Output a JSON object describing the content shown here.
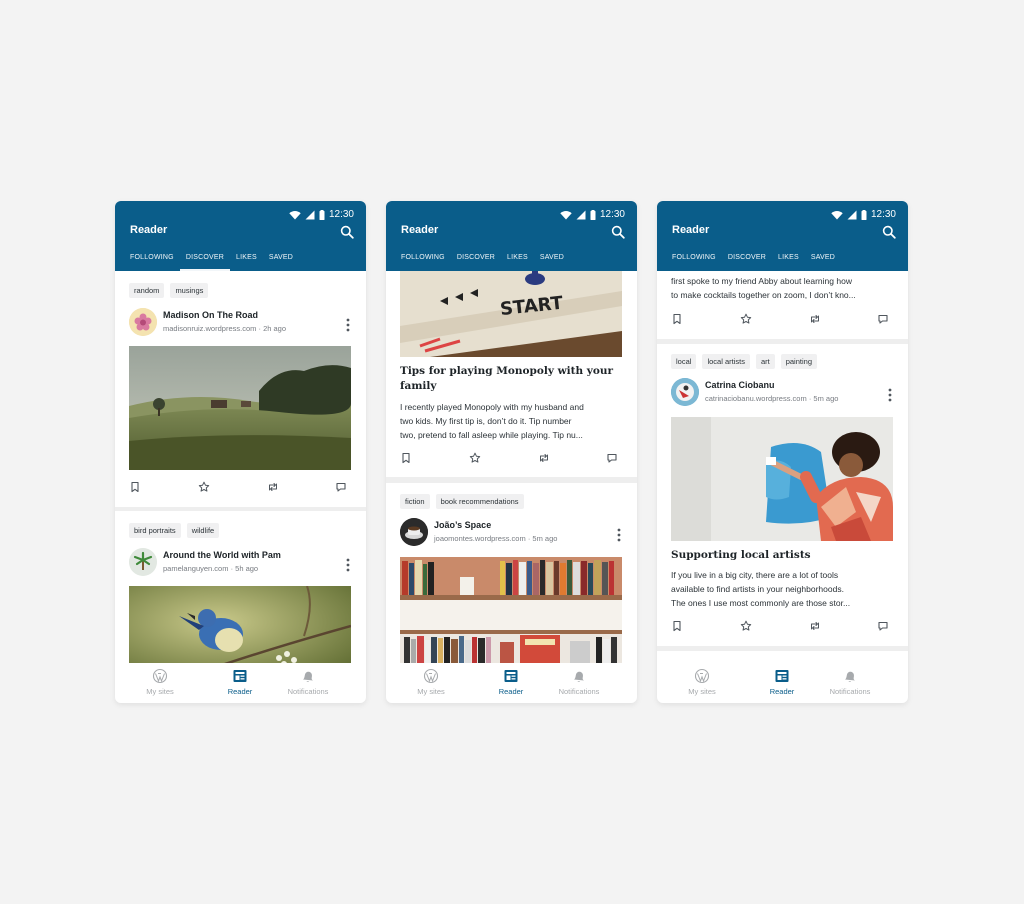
{
  "phones": [
    {
      "status": {
        "time": "12:30"
      },
      "app_title": "Reader",
      "tabs": [
        "FOLLOWING",
        "DISCOVER",
        "LIKES",
        "SAVED"
      ],
      "active_tab": "DISCOVER",
      "posts": [
        {
          "tags": [
            "random",
            "musings"
          ],
          "site_name": "Madison On The Road",
          "site_url": "madisonruiz.wordpress.com",
          "time": "2h ago",
          "image": "rolling-hills-landscape"
        },
        {
          "tags": [
            "bird portraits",
            "wildlife"
          ],
          "site_name": "Around the World with Pam",
          "site_url": "pamelanguyen.com",
          "time": "5h ago",
          "image": "blue-bird-on-branch"
        }
      ],
      "bottom_nav": [
        "My sites",
        "Reader",
        "Notifications"
      ],
      "active_nav": "Reader"
    },
    {
      "status": {
        "time": "12:30"
      },
      "app_title": "Reader",
      "tabs": [
        "FOLLOWING",
        "DISCOVER",
        "LIKES",
        "SAVED"
      ],
      "active_tab": "DISCOVER",
      "posts": [
        {
          "image_text": "START",
          "title_line1": "Tips for playing Monopoly with your",
          "title_line2": "family",
          "excerpt": [
            "I recently played Monopoly with my husband and",
            "two kids. My first tip is, don’t do it. Tip number",
            "two, pretend to fall asleep while playing. Tip nu..."
          ]
        },
        {
          "tags": [
            "fiction",
            "book recommendations"
          ],
          "site_name": "João’s Space",
          "site_url": "joaomontes.wordpress.com",
          "time": "5m ago",
          "image": "bookshelf"
        }
      ],
      "bottom_nav": [
        "My sites",
        "Reader",
        "Notifications"
      ],
      "active_nav": "Reader"
    },
    {
      "status": {
        "time": "12:30"
      },
      "app_title": "Reader",
      "tabs": [
        "FOLLOWING",
        "DISCOVER",
        "LIKES",
        "SAVED"
      ],
      "active_tab": "DISCOVER",
      "posts": [
        {
          "excerpt": [
            "first spoke to my friend Abby about learning how",
            "to make cocktails together on zoom, I don’t kno..."
          ]
        },
        {
          "tags": [
            "local",
            "local artists",
            "art",
            "painting"
          ],
          "site_name": "Catrina Ciobanu",
          "site_url": "catrinaciobanu.wordpress.com",
          "time": "5m ago",
          "image": "person-painting-wall",
          "title": "Supporting local artists",
          "excerpt": [
            "If you live in a big city, there are a lot of tools",
            "available to find artists in your neighborhoods.",
            "The ones I use most commonly are those stor..."
          ]
        }
      ],
      "bottom_nav": [
        "My sites",
        "Reader",
        "Notifications"
      ],
      "active_nav": "Reader"
    }
  ],
  "meta_separator": "·",
  "colors": {
    "brand": "#0a5d8a",
    "background": "#f3f3f3"
  },
  "icons": [
    "wifi-icon",
    "signal-icon",
    "battery-icon",
    "search-icon",
    "kebab-menu-icon",
    "bookmark-icon",
    "star-icon",
    "reblog-icon",
    "comment-icon",
    "wordpress-icon",
    "reader-icon",
    "bell-icon"
  ]
}
